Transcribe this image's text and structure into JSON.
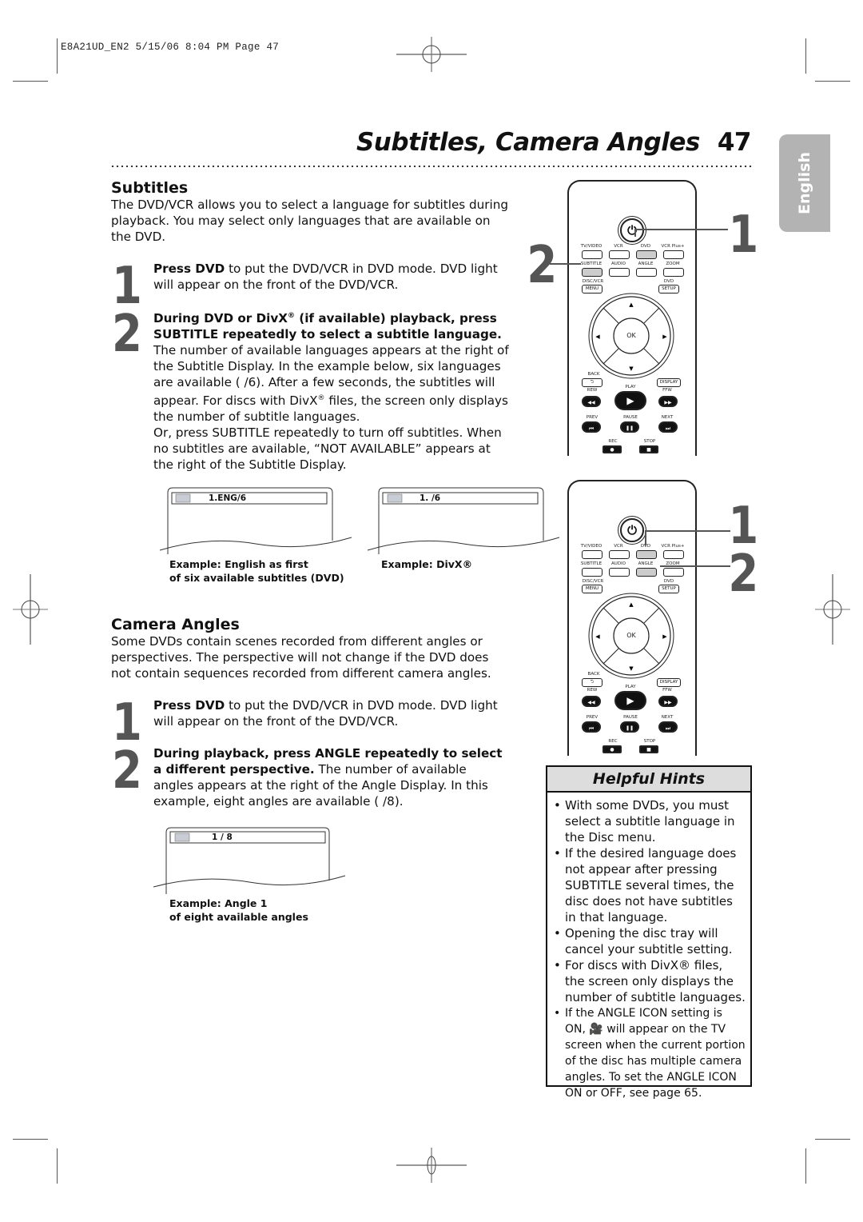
{
  "slug": "E8A21UD_EN2  5/15/06  8:04 PM  Page 47",
  "header": {
    "title": "Subtitles, Camera Angles",
    "page_number": "47"
  },
  "language_tab": "English",
  "subtitles": {
    "heading": "Subtitles",
    "intro": "The DVD/VCR allows you to select a language for subtitles during playback. You may select only languages that are available on the DVD.",
    "step1": {
      "num": "1",
      "bold": "Press DVD",
      "text": " to put the DVD/VCR in DVD mode. DVD light will appear on the front of the DVD/VCR."
    },
    "step2": {
      "num": "2",
      "bold_a": "During DVD or DivX",
      "reg": "®",
      "bold_b": " (if available) playback, press SUBTITLE repeatedly to select a subtitle language.",
      "text_a": " The number of available languages appears at the right of the Subtitle Display. In the example below, six languages are available (  /6). After a few seconds, the subtitles will appear. For discs with DivX",
      "text_b": " files, the screen only displays the number of subtitle languages.",
      "text_c": "Or, press SUBTITLE repeatedly to turn off subtitles. When no subtitles are available, “NOT AVAILABLE” appears at the right of the Subtitle Display."
    },
    "examples": [
      {
        "osd": "1.ENG/6",
        "caption_line1": "Example: English as first",
        "caption_line2": "of six available subtitles (DVD)"
      },
      {
        "osd": "1. /6",
        "caption_line1": "Example: DivX®",
        "caption_line2": ""
      }
    ]
  },
  "camera_angles": {
    "heading": "Camera Angles",
    "intro": "Some DVDs contain scenes recorded from different angles or perspectives. The perspective will not change if the DVD does not contain sequences recorded from different camera angles.",
    "step1": {
      "num": "1",
      "bold": "Press DVD",
      "text": " to put the DVD/VCR in DVD mode. DVD light will appear on the front of the DVD/VCR."
    },
    "step2": {
      "num": "2",
      "bold": "During playback, press ANGLE repeatedly to select a different perspective.",
      "text": " The number of available angles appears at the right of the Angle Display. In this example, eight angles are available (  /8)."
    },
    "example": {
      "osd": "1 / 8",
      "caption_line1": "Example: Angle 1",
      "caption_line2": "of eight available angles"
    }
  },
  "remote": {
    "row1": [
      "TV/VIDEO",
      "VCR",
      "DVD",
      "VCR Plus+"
    ],
    "row2": [
      "SUBTITLE",
      "AUDIO",
      "ANGLE",
      "ZOOM"
    ],
    "disc_vcr": "DISC/VCR",
    "menu": "MENU",
    "dvd": "DVD",
    "setup": "SETUP",
    "ok": "OK",
    "back": "BACK",
    "display": "DISPLAY",
    "play": "PLAY",
    "rew": "REW",
    "ffw": "FFW",
    "prev": "PREV",
    "pause": "PAUSE",
    "next": "NEXT",
    "rec": "REC",
    "stop": "STOP"
  },
  "callouts": {
    "top_1": "1",
    "top_2": "2",
    "bottom_1": "1",
    "bottom_2": "2"
  },
  "hints": {
    "title": "Helpful Hints",
    "items": [
      "With some DVDs, you must select a subtitle language in the Disc menu.",
      "If the desired language does not appear after pressing SUBTITLE several times, the disc does not have subtitles in that language.",
      "Opening the disc tray will cancel your subtitle setting.",
      "For discs with DivX® files, the screen only displays the number of subtitle languages.",
      "If the ANGLE ICON setting is ON, 🎥 will appear on the TV screen when the current portion of the disc has multiple camera angles. To set the ANGLE ICON ON or OFF, see page 65."
    ]
  }
}
